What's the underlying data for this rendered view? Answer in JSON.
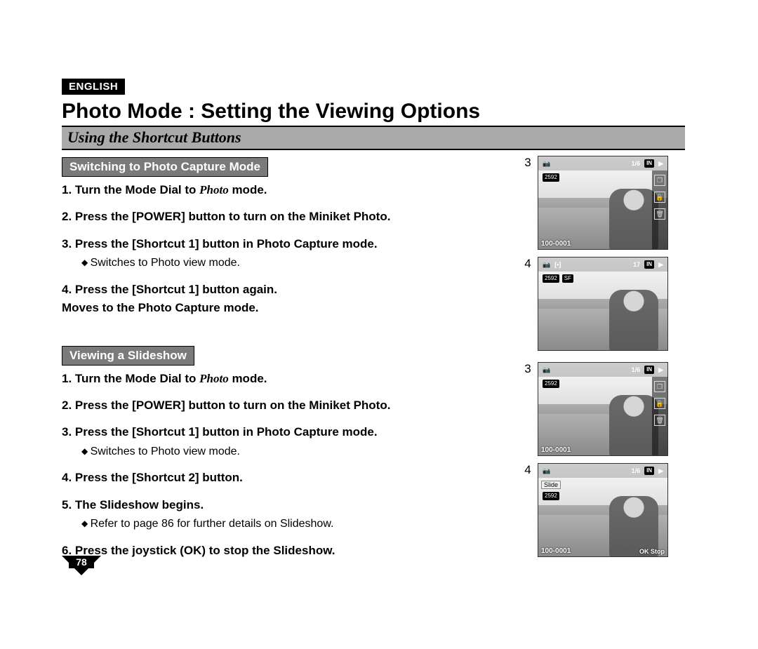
{
  "lang_badge": "ENGLISH",
  "title": "Photo Mode : Setting the Viewing Options",
  "subtitle": "Using the Shortcut Buttons",
  "page_number": "78",
  "section_a": {
    "heading": "Switching to Photo Capture Mode",
    "steps": [
      {
        "n": "1.",
        "pre": "Turn the Mode Dial to ",
        "em": "Photo",
        "post": " mode."
      },
      {
        "n": "2.",
        "text": "Press the [POWER] button to turn on the Miniket Photo."
      },
      {
        "n": "3.",
        "text": "Press the [Shortcut 1] button in Photo Capture mode.",
        "bullets": [
          "Switches to Photo view mode."
        ]
      },
      {
        "n": "4.",
        "text": "Press the [Shortcut 1] button again.",
        "text2": "Moves to the Photo Capture mode."
      }
    ]
  },
  "section_b": {
    "heading": "Viewing a Slideshow",
    "steps": [
      {
        "n": "1.",
        "pre": "Turn the Mode Dial to ",
        "em": "Photo",
        "post": " mode."
      },
      {
        "n": "2.",
        "text": "Press the [POWER] button to turn on the Miniket Photo."
      },
      {
        "n": "3.",
        "text": "Press the [Shortcut 1] button in Photo Capture mode.",
        "bullets": [
          "Switches to Photo view mode."
        ]
      },
      {
        "n": "4.",
        "text": "Press the [Shortcut 2] button."
      },
      {
        "n": "5.",
        "text": "The Slideshow begins.",
        "bullets": [
          "Refer to page 86 for further details on Slideshow."
        ]
      },
      {
        "n": "6.",
        "text": "Press the joystick (OK) to stop the Slideshow."
      }
    ]
  },
  "figures": {
    "a3": {
      "tag": "3",
      "counter": "1/6",
      "mem": "IN",
      "res": "2592",
      "filenum": "100-0001"
    },
    "a4": {
      "tag": "4",
      "meter": "[•]",
      "shots": "17",
      "mem": "IN",
      "res": "2592"
    },
    "b3": {
      "tag": "3",
      "counter": "1/6",
      "mem": "IN",
      "res": "2592",
      "filenum": "100-0001"
    },
    "b4": {
      "tag": "4",
      "slide": "Slide",
      "counter": "1/6",
      "mem": "IN",
      "res": "2592",
      "filenum": "100-0001",
      "okstop": "OK Stop"
    }
  },
  "icons": {
    "camera": "📷",
    "play": "▶",
    "layers": "❐",
    "lock": "🔒",
    "trash": "🗑"
  }
}
